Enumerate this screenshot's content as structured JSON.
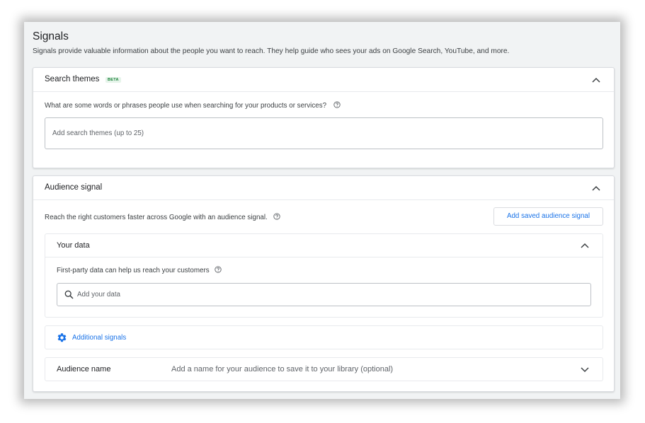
{
  "signals": {
    "title": "Signals",
    "description": "Signals provide valuable information about the people you want to reach. They help guide who sees your ads on Google Search, YouTube, and more."
  },
  "search_themes": {
    "title": "Search themes",
    "badge": "BETA",
    "question": "What are some words or phrases people use when searching for your products or services?",
    "input_placeholder": "Add search themes (up to 25)"
  },
  "audience_signal": {
    "title": "Audience signal",
    "description": "Reach the right customers faster across Google with an audience signal.",
    "add_saved_button": "Add saved audience signal",
    "your_data": {
      "title": "Your data",
      "description": "First-party data can help us reach your customers",
      "search_placeholder": "Add your data"
    },
    "additional_signals_label": "Additional signals",
    "audience_name": {
      "label": "Audience name",
      "hint": "Add a name for your audience to save it to your library (optional)"
    }
  },
  "colors": {
    "accent": "#1a73e8",
    "beta_text": "#188038",
    "beta_bg": "#e6f4ea",
    "background": "#f1f3f4"
  },
  "icons": [
    "chevron-up-icon",
    "help-circle-icon",
    "search-icon",
    "gear-icon",
    "chevron-down-icon"
  ]
}
